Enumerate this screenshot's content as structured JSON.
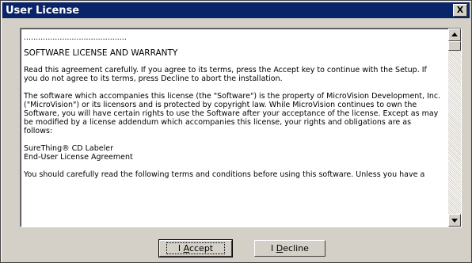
{
  "window": {
    "title": "User License",
    "close_label": "X"
  },
  "license": {
    "separator": "...........................................",
    "heading": "SOFTWARE LICENSE AND WARRANTY",
    "para1": "Read this agreement carefully.  If you agree to its terms, press the Accept key to continue with the Setup.  If you do not agree to its terms, press Decline to abort the installation.",
    "para2": "The software which accompanies this license (the \"Software\") is the property of MicroVision Development, Inc. (\"MicroVision\") or its licensors and is protected by copyright law.  While MicroVision continues to own the Software, you will have certain rights to use the Software after your acceptance of the license.  Except as may be modified by a license addendum which accompanies this license, your rights and obligations are as follows:",
    "product_line1": "SureThing® CD Labeler",
    "product_line2": "End-User License Agreement",
    "para3": "You should carefully read the following terms and conditions before using this software.  Unless you have a"
  },
  "buttons": {
    "accept": {
      "prefix": "I ",
      "hotkey": "A",
      "rest": "ccept"
    },
    "decline": {
      "prefix": "I ",
      "hotkey": "D",
      "rest": "ecline"
    }
  }
}
